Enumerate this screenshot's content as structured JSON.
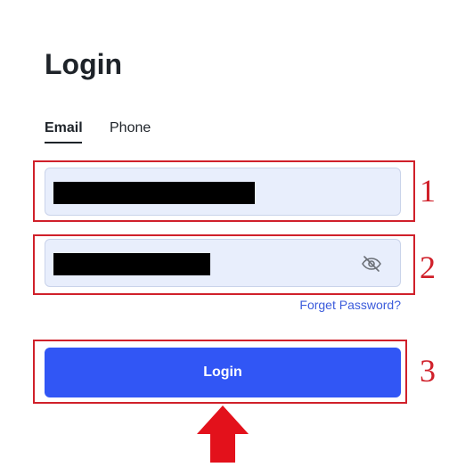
{
  "login": {
    "title": "Login",
    "tabs": [
      {
        "label": "Email",
        "active": true
      },
      {
        "label": "Phone",
        "active": false
      }
    ],
    "email_field": {
      "value": "",
      "redacted": true
    },
    "password_field": {
      "value": "",
      "redacted": true,
      "toggle_icon": "eye-off-icon"
    },
    "forgot_password_label": "Forget Password?",
    "login_button_label": "Login"
  },
  "annotations": {
    "step_numbers": [
      "1",
      "2",
      "3"
    ],
    "highlight_color": "#d0202a",
    "pointer_icon": "arrow-up-icon"
  },
  "colors": {
    "primary_button": "#3156f5",
    "input_background": "#e8eefc",
    "link": "#3b5bdb",
    "annotation_red": "#d0202a"
  }
}
